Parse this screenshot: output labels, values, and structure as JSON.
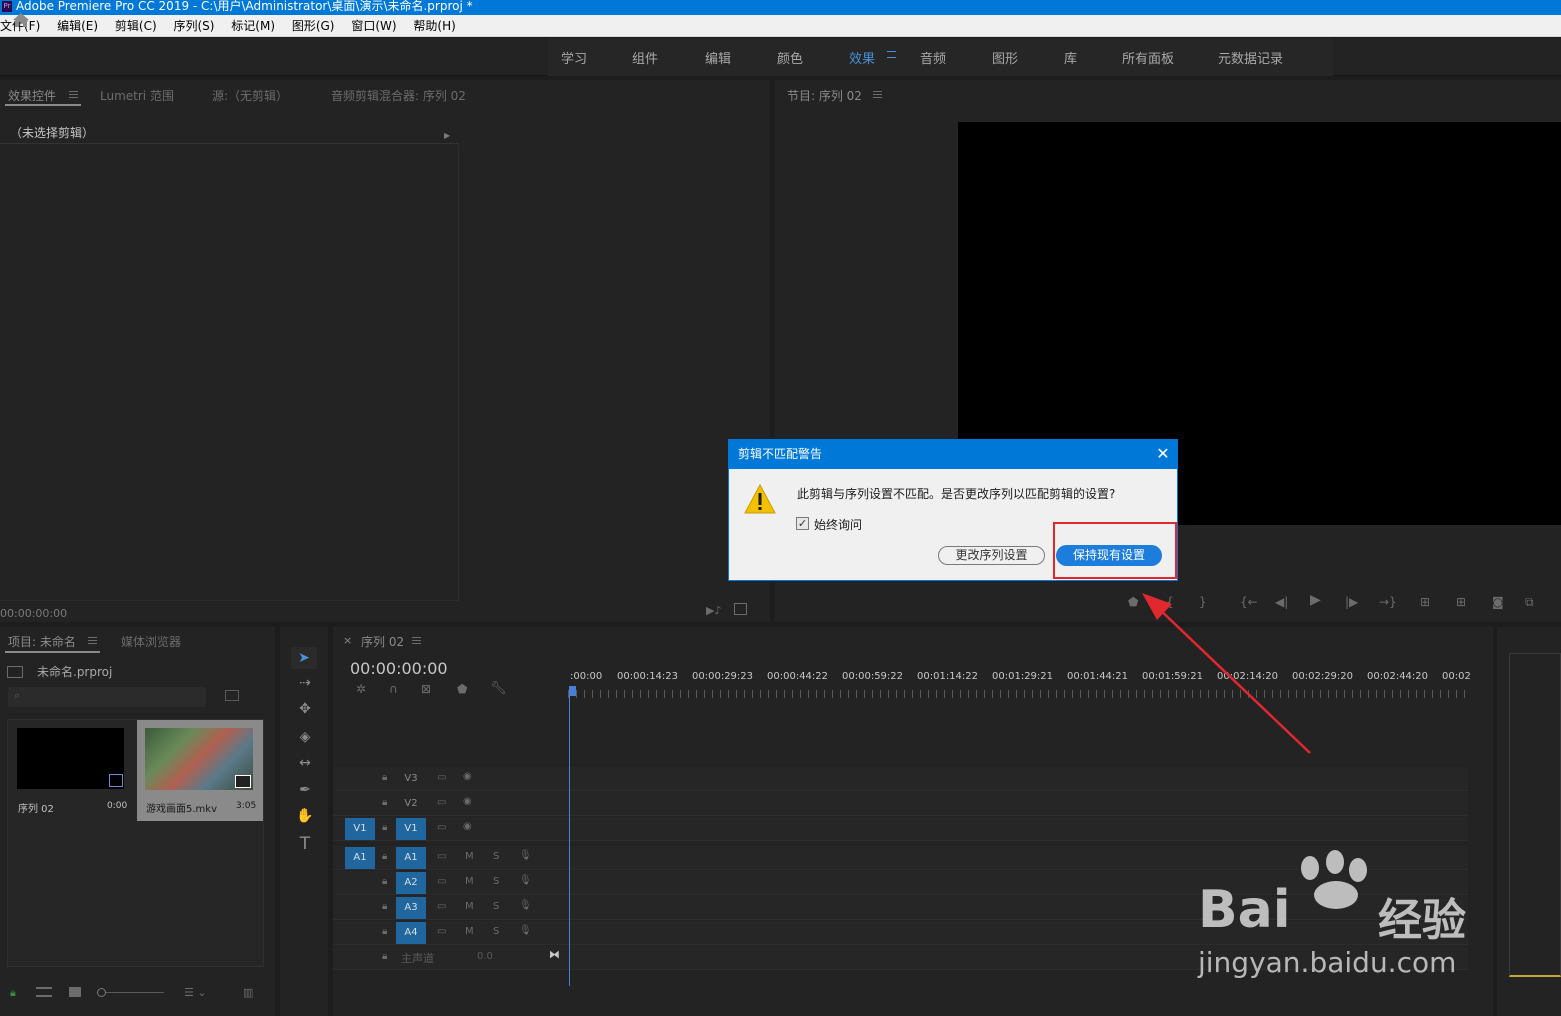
{
  "window": {
    "title": "Adobe Premiere Pro CC 2019 - C:\\用户\\Administrator\\桌面\\演示\\未命名.prproj *",
    "app_icon": "Pr"
  },
  "menu": [
    "文件(F)",
    "编辑(E)",
    "剪辑(C)",
    "序列(S)",
    "标记(M)",
    "图形(G)",
    "窗口(W)",
    "帮助(H)"
  ],
  "workspaces": {
    "items": [
      "学习",
      "组件",
      "编辑",
      "颜色",
      "效果",
      "音频",
      "图形",
      "库",
      "所有面板",
      "元数据记录"
    ],
    "active": "效果"
  },
  "effects_panel": {
    "tabs": [
      "效果控件",
      "Lumetri 范围",
      "源:（无剪辑）",
      "音频剪辑混合器: 序列 02"
    ],
    "no_clip": "（未选择剪辑）",
    "timecode": "00:00:00:00"
  },
  "program_panel": {
    "tab": "节目: 序列 02"
  },
  "project_panel": {
    "tabs": [
      "项目: 未命名",
      "媒体浏览器"
    ],
    "project_file": "未命名.prproj",
    "items": [
      {
        "name": "序列 02",
        "duration": "0:00"
      },
      {
        "name": "游戏画面5.mkv",
        "duration": "3:05"
      }
    ]
  },
  "timeline": {
    "tab": "序列 02",
    "timecode": "00:00:00:00",
    "ruler": [
      ":00:00",
      "00:00:14:23",
      "00:00:29:23",
      "00:00:44:22",
      "00:00:59:22",
      "00:01:14:22",
      "00:01:29:21",
      "00:01:44:21",
      "00:01:59:21",
      "00:02:14:20",
      "00:02:29:20",
      "00:02:44:20",
      "00:02"
    ],
    "video_tracks": [
      "V3",
      "V2",
      "V1"
    ],
    "audio_tracks": [
      "A1",
      "A2",
      "A3",
      "A4"
    ],
    "source_v": "V1",
    "source_a": "A1",
    "master": "主声道",
    "master_value": "0.0",
    "mute_label": "M",
    "solo_label": "S"
  },
  "dialog": {
    "title": "剪辑不匹配警告",
    "message": "此剪辑与序列设置不匹配。是否更改序列以匹配剪辑的设置?",
    "checkbox_label": "始终询问",
    "checkbox_checked": true,
    "change_button": "更改序列设置",
    "keep_button": "保持现有设置"
  },
  "watermark": {
    "logo": "Bai",
    "logo_cn": "经验",
    "url": "jingyan.baidu.com"
  },
  "colors": {
    "accent": "#0078d7",
    "track_active": "#2067a0",
    "highlight": "#e0282e"
  }
}
